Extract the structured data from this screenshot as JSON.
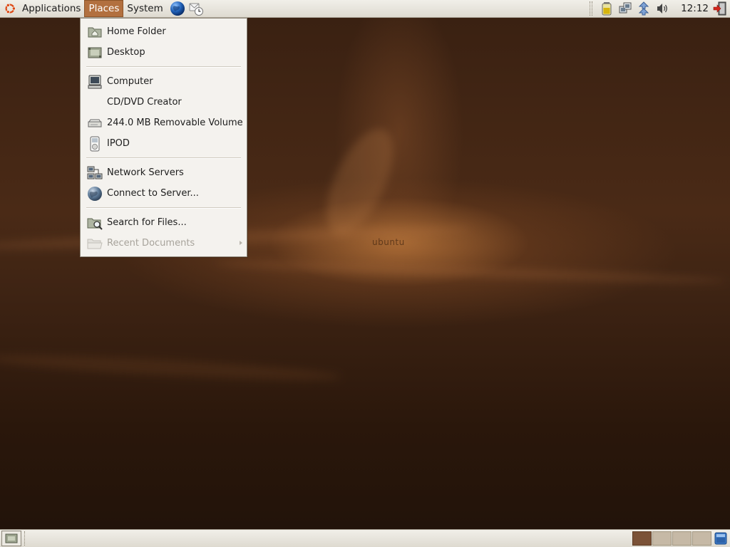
{
  "top_panel": {
    "menus": [
      {
        "label": "Applications",
        "active": false
      },
      {
        "label": "Places",
        "active": true
      },
      {
        "label": "System",
        "active": false
      }
    ],
    "launchers": [
      "web-browser-icon",
      "mail-client-icon"
    ],
    "tray_icons": [
      "battery-icon",
      "network-icon",
      "update-notifier-icon",
      "volume-icon",
      "logout-icon"
    ],
    "clock": "12:12"
  },
  "places_menu": {
    "groups": [
      [
        {
          "label": "Home Folder",
          "icon": "home-folder-icon",
          "disabled": false
        },
        {
          "label": "Desktop",
          "icon": "desktop-icon",
          "disabled": false
        }
      ],
      [
        {
          "label": "Computer",
          "icon": "computer-icon",
          "disabled": false
        },
        {
          "label": "CD/DVD Creator",
          "icon": "",
          "disabled": false
        },
        {
          "label": "244.0 MB Removable Volume",
          "icon": "removable-drive-icon",
          "disabled": false
        },
        {
          "label": "IPOD",
          "icon": "ipod-icon",
          "disabled": false
        }
      ],
      [
        {
          "label": "Network Servers",
          "icon": "network-servers-icon",
          "disabled": false
        },
        {
          "label": "Connect to Server...",
          "icon": "globe-icon",
          "disabled": false
        }
      ],
      [
        {
          "label": "Search for Files...",
          "icon": "search-folder-icon",
          "disabled": false
        },
        {
          "label": "Recent Documents",
          "icon": "folder-icon",
          "disabled": true,
          "has_submenu": true
        }
      ]
    ]
  },
  "bottom_panel": {
    "workspaces": 4,
    "current_workspace": 1
  },
  "desktop": {
    "wallpaper_brand": "ubuntu"
  },
  "colors": {
    "active_menu": "#b2703f",
    "panel": "#e6e3dc",
    "wallpaper": "#3a2112"
  }
}
